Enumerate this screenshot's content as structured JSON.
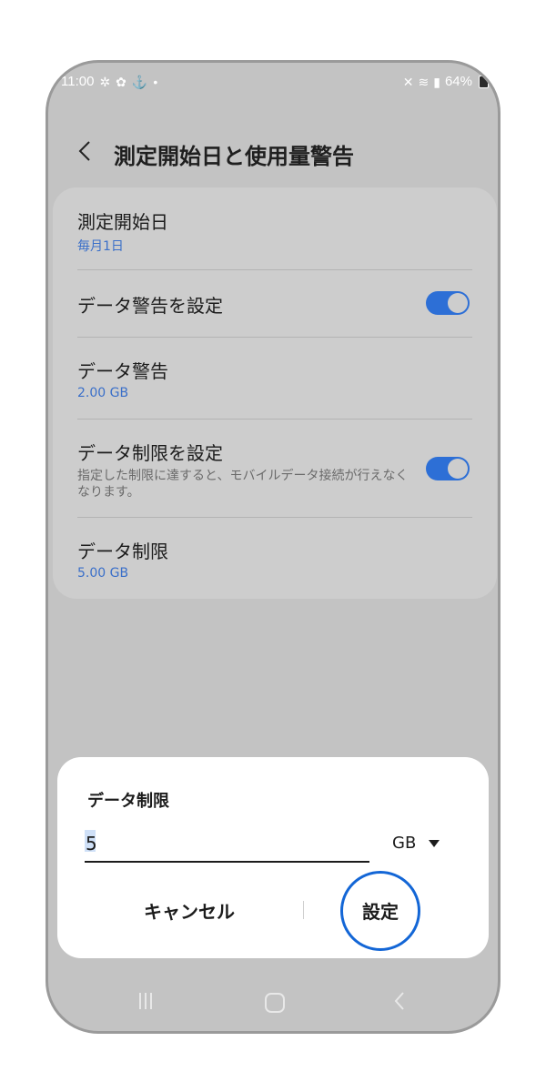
{
  "status_bar": {
    "time": "11:00",
    "left_icons": [
      "flower-icon",
      "gallery-icon",
      "usb-icon",
      "dot-icon"
    ],
    "battery": "64%",
    "right_icons": [
      "mute-icon",
      "wifi-icon",
      "signal-icon",
      "battery-icon"
    ]
  },
  "header": {
    "title": "測定開始日と使用量警告",
    "back_icon": "chevron-left-icon"
  },
  "settings": [
    {
      "title": "測定開始日",
      "subtitle": "毎月1日"
    },
    {
      "title": "データ警告を設定",
      "toggle": true
    },
    {
      "title": "データ警告",
      "subtitle": "2.00 GB"
    },
    {
      "title": "データ制限を設定",
      "description": "指定した制限に達すると、モバイルデータ接続が行えなくなります。",
      "toggle": true
    },
    {
      "title": "データ制限",
      "subtitle": "5.00 GB"
    }
  ],
  "dialog": {
    "title": "データ制限",
    "input_value": "5",
    "unit": "GB",
    "cancel_label": "キャンセル",
    "confirm_label": "設定"
  },
  "colors": {
    "accent": "#2d6fd6",
    "highlight": "#1366d6",
    "subtitle": "#3a6fc9"
  }
}
